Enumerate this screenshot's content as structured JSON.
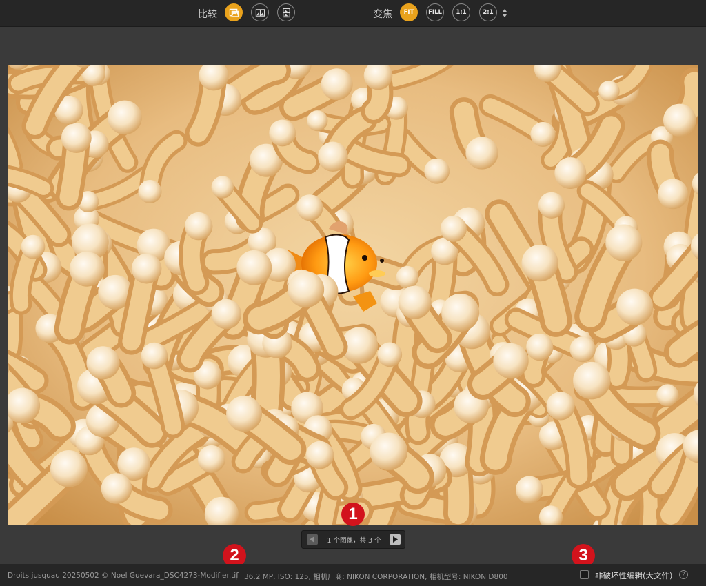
{
  "toolbar": {
    "compare_label": "比较",
    "zoom_label": "变焦",
    "compare_icons": [
      "single-view-icon",
      "side-by-side-icon",
      "split-view-icon"
    ],
    "zoom_options": [
      "FIT",
      "FILL",
      "1:1",
      "2:1"
    ],
    "zoom_selected": "FIT",
    "accent": "#e9a21c"
  },
  "image": {
    "subject": "clownfish-in-anemone"
  },
  "pager": {
    "text": "1 个图像，共 3 个"
  },
  "status": {
    "file_info": "Droits jusquau 20250502 © Noel Guevara_DSC4273-Modifier.tif",
    "separator": "|",
    "camera_info": "36.2 MP, ISO: 125, 相机厂商: NIKON CORPORATION, 相机型号: NIKON D800",
    "nondestructive_label": "非破坏性编辑(大文件)",
    "nondestructive_checked": false,
    "help_glyph": "?"
  },
  "badges": [
    "1",
    "2",
    "3"
  ],
  "badge_color": "#d2131c"
}
